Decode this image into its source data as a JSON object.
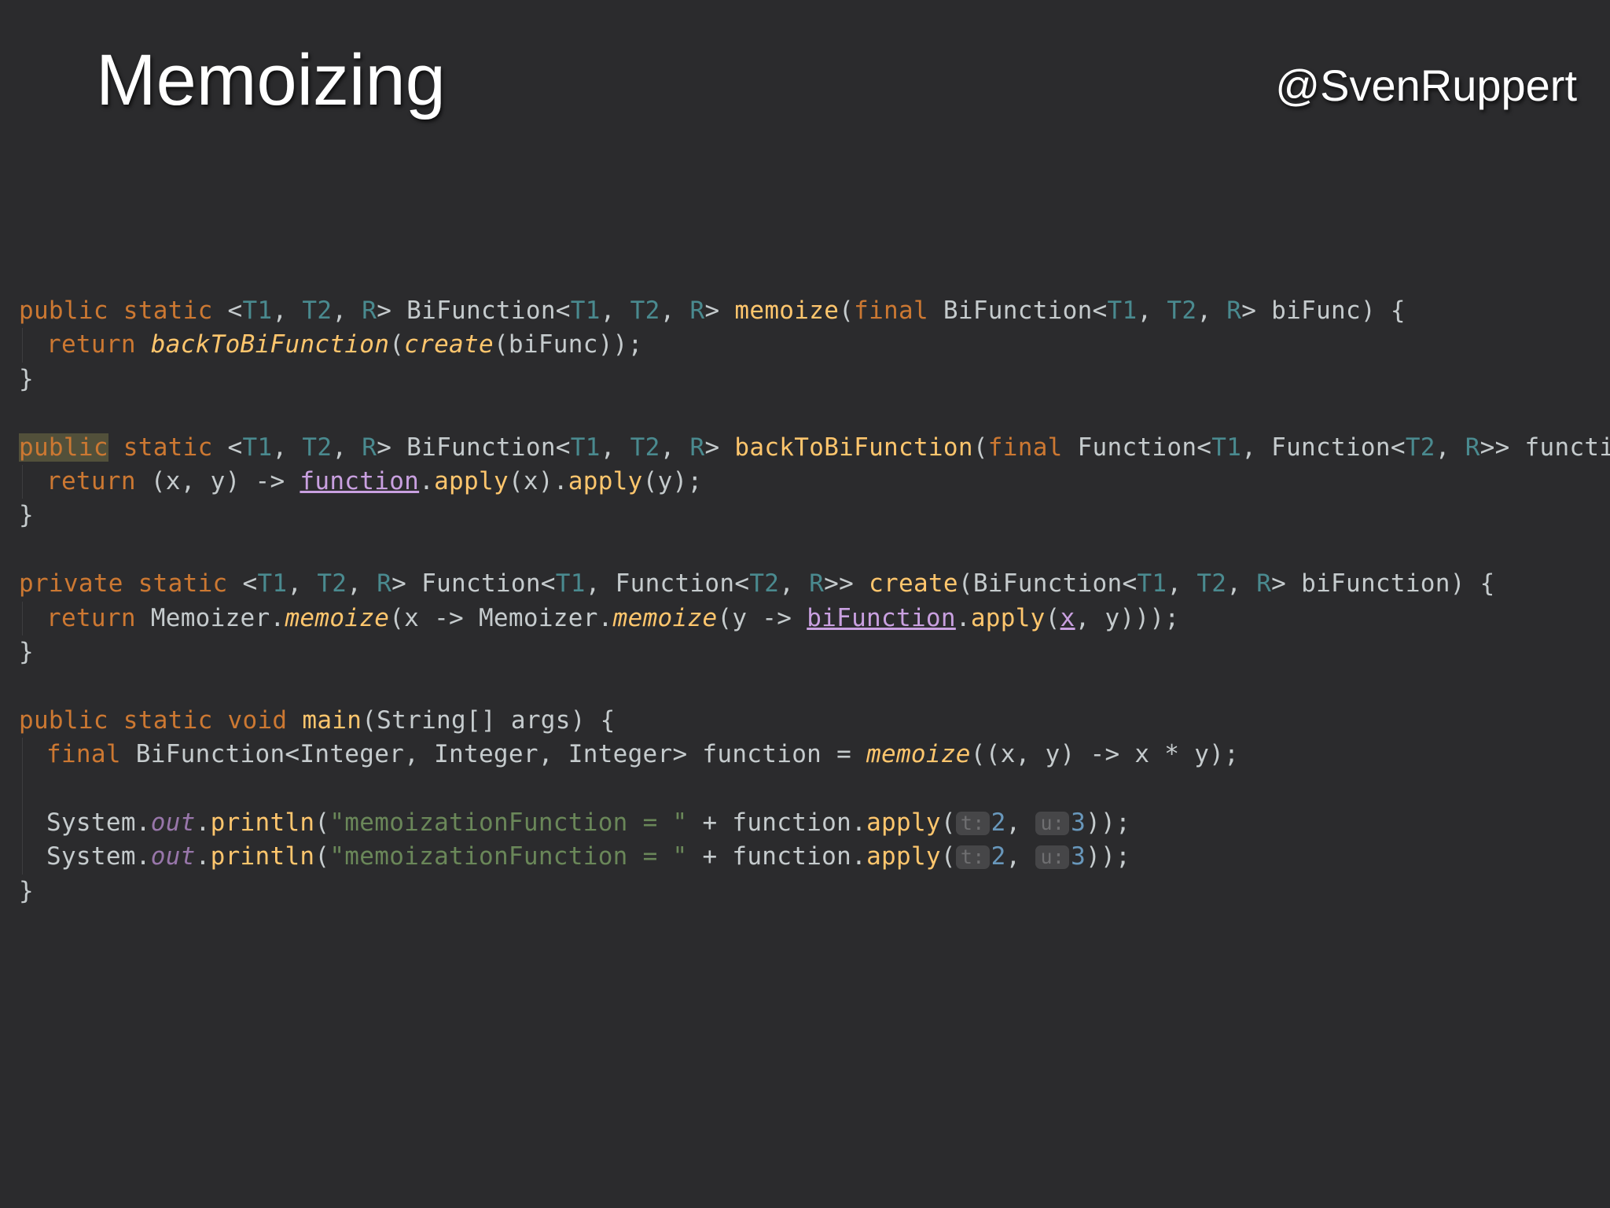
{
  "slide": {
    "title": "Memoizing",
    "handle": "@SvenRuppert"
  },
  "token_colors": {
    "kw": "#cc7832",
    "tp": "#4a8a8f",
    "m": "#ffc66d",
    "mi": "#ffc66d",
    "pl": "#c5cbcd",
    "st": "#6a8759",
    "nm": "#6897bb",
    "fi": "#9876aa",
    "pu": "#c9a0e0",
    "hint_bg": "#464648",
    "background": "#2b2b2d"
  },
  "code": [
    {
      "indent": false,
      "tokens": [
        {
          "t": "public",
          "c": "kw"
        },
        {
          "t": " ",
          "c": "pl"
        },
        {
          "t": "static",
          "c": "kw"
        },
        {
          "t": " <",
          "c": "pl"
        },
        {
          "t": "T1",
          "c": "tp"
        },
        {
          "t": ", ",
          "c": "pl"
        },
        {
          "t": "T2",
          "c": "tp"
        },
        {
          "t": ", ",
          "c": "pl"
        },
        {
          "t": "R",
          "c": "tp"
        },
        {
          "t": "> BiFunction<",
          "c": "pl"
        },
        {
          "t": "T1",
          "c": "tp"
        },
        {
          "t": ", ",
          "c": "pl"
        },
        {
          "t": "T2",
          "c": "tp"
        },
        {
          "t": ", ",
          "c": "pl"
        },
        {
          "t": "R",
          "c": "tp"
        },
        {
          "t": "> ",
          "c": "pl"
        },
        {
          "t": "memoize",
          "c": "m"
        },
        {
          "t": "(",
          "c": "pl"
        },
        {
          "t": "final",
          "c": "kw"
        },
        {
          "t": " BiFunction<",
          "c": "pl"
        },
        {
          "t": "T1",
          "c": "tp"
        },
        {
          "t": ", ",
          "c": "pl"
        },
        {
          "t": "T2",
          "c": "tp"
        },
        {
          "t": ", ",
          "c": "pl"
        },
        {
          "t": "R",
          "c": "tp"
        },
        {
          "t": "> biFunc) {",
          "c": "pl"
        }
      ]
    },
    {
      "indent": true,
      "tokens": [
        {
          "t": "return",
          "c": "kw"
        },
        {
          "t": " ",
          "c": "pl"
        },
        {
          "t": "backToBiFunction",
          "c": "mi"
        },
        {
          "t": "(",
          "c": "pl"
        },
        {
          "t": "create",
          "c": "mi"
        },
        {
          "t": "(biFunc));",
          "c": "pl"
        }
      ]
    },
    {
      "indent": false,
      "tokens": [
        {
          "t": "}",
          "c": "pl"
        }
      ]
    },
    {
      "indent": false,
      "tokens": []
    },
    {
      "indent": false,
      "tokens": [
        {
          "t": "public",
          "c": "kw",
          "hl": true
        },
        {
          "t": " ",
          "c": "pl"
        },
        {
          "t": "static",
          "c": "kw"
        },
        {
          "t": " <",
          "c": "pl"
        },
        {
          "t": "T1",
          "c": "tp"
        },
        {
          "t": ", ",
          "c": "pl"
        },
        {
          "t": "T2",
          "c": "tp"
        },
        {
          "t": ", ",
          "c": "pl"
        },
        {
          "t": "R",
          "c": "tp"
        },
        {
          "t": "> BiFunction<",
          "c": "pl"
        },
        {
          "t": "T1",
          "c": "tp"
        },
        {
          "t": ", ",
          "c": "pl"
        },
        {
          "t": "T2",
          "c": "tp"
        },
        {
          "t": ", ",
          "c": "pl"
        },
        {
          "t": "R",
          "c": "tp"
        },
        {
          "t": "> ",
          "c": "pl"
        },
        {
          "t": "backToBiFunction",
          "c": "m"
        },
        {
          "t": "(",
          "c": "pl"
        },
        {
          "t": "final",
          "c": "kw"
        },
        {
          "t": " Function<",
          "c": "pl"
        },
        {
          "t": "T1",
          "c": "tp"
        },
        {
          "t": ", Function<",
          "c": "pl"
        },
        {
          "t": "T2",
          "c": "tp"
        },
        {
          "t": ", ",
          "c": "pl"
        },
        {
          "t": "R",
          "c": "tp"
        },
        {
          "t": ">> function) {",
          "c": "pl"
        }
      ]
    },
    {
      "indent": true,
      "tokens": [
        {
          "t": "return",
          "c": "kw"
        },
        {
          "t": " (x, y) -> ",
          "c": "pl"
        },
        {
          "t": "function",
          "c": "pu",
          "ul": true
        },
        {
          "t": ".",
          "c": "pl"
        },
        {
          "t": "apply",
          "c": "m"
        },
        {
          "t": "(x).",
          "c": "pl"
        },
        {
          "t": "apply",
          "c": "m"
        },
        {
          "t": "(y);",
          "c": "pl"
        }
      ]
    },
    {
      "indent": false,
      "tokens": [
        {
          "t": "}",
          "c": "pl"
        }
      ]
    },
    {
      "indent": false,
      "tokens": []
    },
    {
      "indent": false,
      "tokens": [
        {
          "t": "private",
          "c": "kw"
        },
        {
          "t": " ",
          "c": "pl"
        },
        {
          "t": "static",
          "c": "kw"
        },
        {
          "t": " <",
          "c": "pl"
        },
        {
          "t": "T1",
          "c": "tp"
        },
        {
          "t": ", ",
          "c": "pl"
        },
        {
          "t": "T2",
          "c": "tp"
        },
        {
          "t": ", ",
          "c": "pl"
        },
        {
          "t": "R",
          "c": "tp"
        },
        {
          "t": "> Function<",
          "c": "pl"
        },
        {
          "t": "T1",
          "c": "tp"
        },
        {
          "t": ", Function<",
          "c": "pl"
        },
        {
          "t": "T2",
          "c": "tp"
        },
        {
          "t": ", ",
          "c": "pl"
        },
        {
          "t": "R",
          "c": "tp"
        },
        {
          "t": ">> ",
          "c": "pl"
        },
        {
          "t": "create",
          "c": "m"
        },
        {
          "t": "(BiFunction<",
          "c": "pl"
        },
        {
          "t": "T1",
          "c": "tp"
        },
        {
          "t": ", ",
          "c": "pl"
        },
        {
          "t": "T2",
          "c": "tp"
        },
        {
          "t": ", ",
          "c": "pl"
        },
        {
          "t": "R",
          "c": "tp"
        },
        {
          "t": "> biFunction) {",
          "c": "pl"
        }
      ]
    },
    {
      "indent": true,
      "tokens": [
        {
          "t": "return",
          "c": "kw"
        },
        {
          "t": " Memoizer.",
          "c": "pl"
        },
        {
          "t": "memoize",
          "c": "mi"
        },
        {
          "t": "(x -> Memoizer.",
          "c": "pl"
        },
        {
          "t": "memoize",
          "c": "mi"
        },
        {
          "t": "(y -> ",
          "c": "pl"
        },
        {
          "t": "biFunction",
          "c": "pu",
          "ul": true
        },
        {
          "t": ".",
          "c": "pl"
        },
        {
          "t": "apply",
          "c": "m"
        },
        {
          "t": "(",
          "c": "pl"
        },
        {
          "t": "x",
          "c": "pu",
          "ul": true
        },
        {
          "t": ", y)));",
          "c": "pl"
        }
      ]
    },
    {
      "indent": false,
      "tokens": [
        {
          "t": "}",
          "c": "pl"
        }
      ]
    },
    {
      "indent": false,
      "tokens": []
    },
    {
      "indent": false,
      "tokens": [
        {
          "t": "public",
          "c": "kw"
        },
        {
          "t": " ",
          "c": "pl"
        },
        {
          "t": "static",
          "c": "kw"
        },
        {
          "t": " ",
          "c": "pl"
        },
        {
          "t": "void",
          "c": "kw"
        },
        {
          "t": " ",
          "c": "pl"
        },
        {
          "t": "main",
          "c": "m"
        },
        {
          "t": "(String[] args) {",
          "c": "pl"
        }
      ]
    },
    {
      "indent": true,
      "tokens": [
        {
          "t": "final",
          "c": "kw"
        },
        {
          "t": " BiFunction<Integer, Integer, Integer> function = ",
          "c": "pl"
        },
        {
          "t": "memoize",
          "c": "mi"
        },
        {
          "t": "((x, y) -> x * y);",
          "c": "pl"
        }
      ]
    },
    {
      "indent": true,
      "tokens": []
    },
    {
      "indent": true,
      "tokens": [
        {
          "t": "System.",
          "c": "pl"
        },
        {
          "t": "out",
          "c": "fi"
        },
        {
          "t": ".",
          "c": "pl"
        },
        {
          "t": "println",
          "c": "m"
        },
        {
          "t": "(",
          "c": "pl"
        },
        {
          "t": "\"memoizationFunction = \"",
          "c": "st"
        },
        {
          "t": " + function.",
          "c": "pl"
        },
        {
          "t": "apply",
          "c": "m"
        },
        {
          "t": "(",
          "c": "pl"
        },
        {
          "t": "t:",
          "c": "hint"
        },
        {
          "t": "2",
          "c": "nm"
        },
        {
          "t": ", ",
          "c": "pl"
        },
        {
          "t": "u:",
          "c": "hint"
        },
        {
          "t": "3",
          "c": "nm"
        },
        {
          "t": "));",
          "c": "pl"
        }
      ]
    },
    {
      "indent": true,
      "tokens": [
        {
          "t": "System.",
          "c": "pl"
        },
        {
          "t": "out",
          "c": "fi"
        },
        {
          "t": ".",
          "c": "pl"
        },
        {
          "t": "println",
          "c": "m"
        },
        {
          "t": "(",
          "c": "pl"
        },
        {
          "t": "\"memoizationFunction = \"",
          "c": "st"
        },
        {
          "t": " + function.",
          "c": "pl"
        },
        {
          "t": "apply",
          "c": "m"
        },
        {
          "t": "(",
          "c": "pl"
        },
        {
          "t": "t:",
          "c": "hint"
        },
        {
          "t": "2",
          "c": "nm"
        },
        {
          "t": ", ",
          "c": "pl"
        },
        {
          "t": "u:",
          "c": "hint"
        },
        {
          "t": "3",
          "c": "nm"
        },
        {
          "t": "));",
          "c": "pl"
        }
      ]
    },
    {
      "indent": false,
      "tokens": [
        {
          "t": "}",
          "c": "pl"
        }
      ]
    }
  ]
}
